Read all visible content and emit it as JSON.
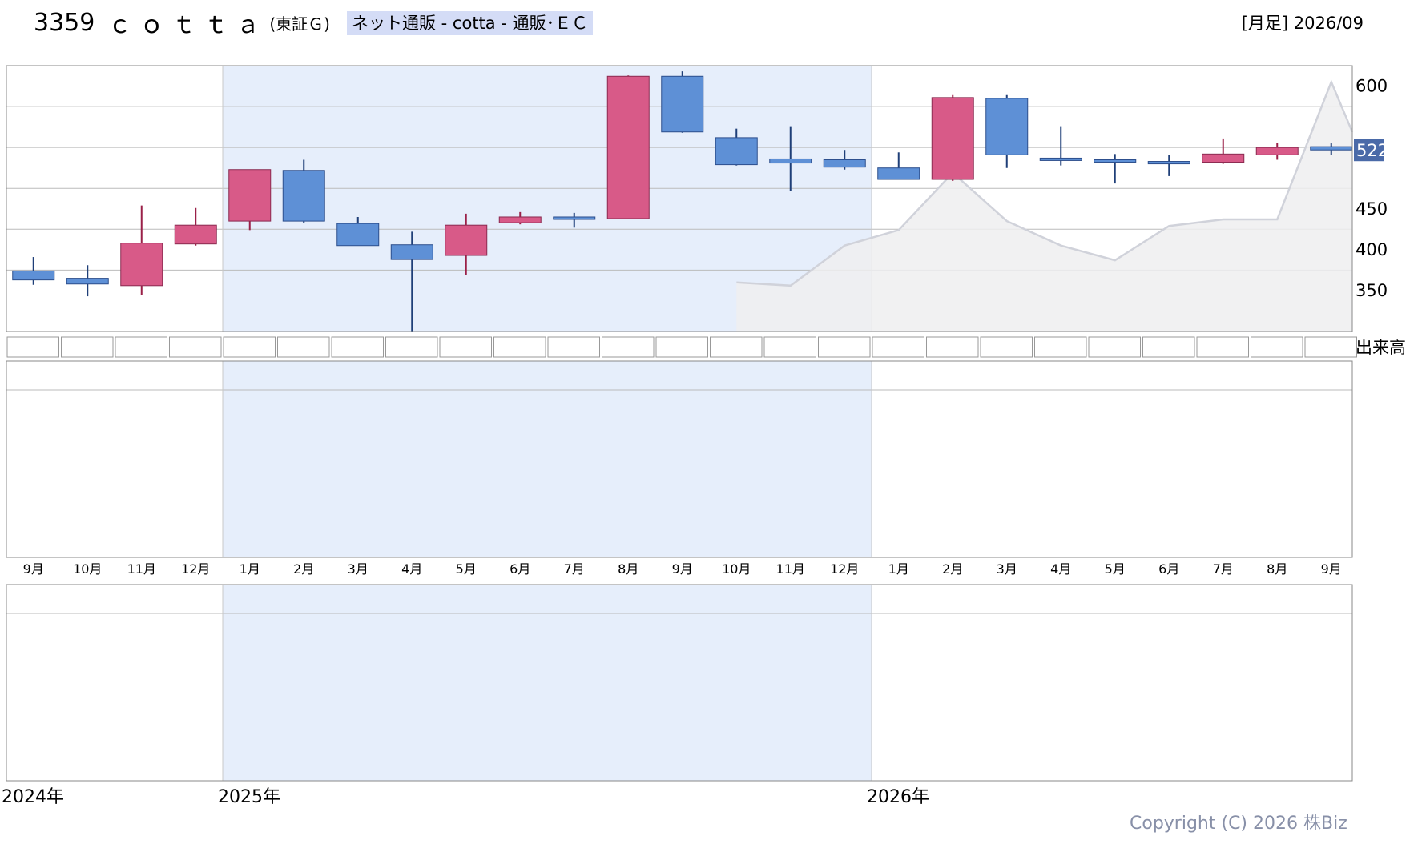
{
  "header": {
    "code": "3359",
    "name": "ｃｏｔｔａ",
    "market": "(東証Ｇ)",
    "sector": "ネット通販 - cotta - 通販･ＥＣ",
    "period": "[月足] 2026/09"
  },
  "copyright": "Copyright (C) 2026 株Biz",
  "volume_label": "出来高",
  "current_price_label": "522",
  "colors": {
    "up": "#d85a88",
    "down": "#5e90d6",
    "wick_down": "#1f3f78",
    "wick_up": "#9a2048",
    "highlight": "#e6eefb",
    "grey_area": "#eeeef0",
    "grid": "#bbbbbb",
    "price_label_bg": "#4a6aa8"
  },
  "chart_data": {
    "type": "candlestick",
    "categories": [
      "9月",
      "10月",
      "11月",
      "12月",
      "1月",
      "2月",
      "3月",
      "4月",
      "5月",
      "6月",
      "7月",
      "8月",
      "9月",
      "10月",
      "11月",
      "12月",
      "1月",
      "2月",
      "3月",
      "4月",
      "5月",
      "6月",
      "7月",
      "8月",
      "9月"
    ],
    "year_labels": [
      {
        "label": "2024年",
        "index": 0
      },
      {
        "label": "2025年",
        "index": 4
      },
      {
        "label": "2026年",
        "index": 16
      }
    ],
    "y_ticks": [
      600,
      450,
      400,
      350
    ],
    "ylim": [
      300,
      625
    ],
    "candles": [
      {
        "o": 374,
        "h": 391,
        "l": 357,
        "c": 363
      },
      {
        "o": 365,
        "h": 381,
        "l": 343,
        "c": 358
      },
      {
        "o": 356,
        "h": 454,
        "l": 345,
        "c": 408
      },
      {
        "o": 407,
        "h": 451,
        "l": 405,
        "c": 430
      },
      {
        "o": 435,
        "h": 455,
        "l": 424,
        "c": 498
      },
      {
        "o": 497,
        "h": 510,
        "l": 433,
        "c": 435
      },
      {
        "o": 432,
        "h": 440,
        "l": 405,
        "c": 405
      },
      {
        "o": 406,
        "h": 422,
        "l": 300,
        "c": 388
      },
      {
        "o": 393,
        "h": 444,
        "l": 369,
        "c": 430
      },
      {
        "o": 433,
        "h": 446,
        "l": 431,
        "c": 440
      },
      {
        "o": 440,
        "h": 445,
        "l": 427,
        "c": 439
      },
      {
        "o": 438,
        "h": 613,
        "l": 438,
        "c": 612
      },
      {
        "o": 612,
        "h": 618,
        "l": 543,
        "c": 544
      },
      {
        "o": 537,
        "h": 548,
        "l": 503,
        "c": 504
      },
      {
        "o": 511,
        "h": 551,
        "l": 472,
        "c": 506
      },
      {
        "o": 510,
        "h": 522,
        "l": 498,
        "c": 501
      },
      {
        "o": 500,
        "h": 519,
        "l": 488,
        "c": 486
      },
      {
        "o": 486,
        "h": 589,
        "l": 484,
        "c": 586
      },
      {
        "o": 585,
        "h": 589,
        "l": 500,
        "c": 516
      },
      {
        "o": 512,
        "h": 551,
        "l": 503,
        "c": 511
      },
      {
        "o": 510,
        "h": 517,
        "l": 481,
        "c": 508
      },
      {
        "o": 508,
        "h": 516,
        "l": 490,
        "c": 505
      },
      {
        "o": 507,
        "h": 536,
        "l": 505,
        "c": 517
      },
      {
        "o": 516,
        "h": 531,
        "l": 510,
        "c": 525
      },
      {
        "o": 526,
        "h": 530,
        "l": 516,
        "c": 522
      }
    ],
    "reference_line": [
      {
        "i": 13,
        "v": 360
      },
      {
        "i": 14,
        "v": 356
      },
      {
        "i": 15,
        "v": 405
      },
      {
        "i": 16,
        "v": 424
      },
      {
        "i": 17,
        "v": 494
      },
      {
        "i": 18,
        "v": 435
      },
      {
        "i": 19,
        "v": 405
      },
      {
        "i": 20,
        "v": 387
      },
      {
        "i": 21,
        "v": 429
      },
      {
        "i": 22,
        "v": 437
      },
      {
        "i": 23,
        "v": 437
      },
      {
        "i": 24,
        "v": 605
      },
      {
        "i": 25,
        "v": 544
      }
    ]
  }
}
